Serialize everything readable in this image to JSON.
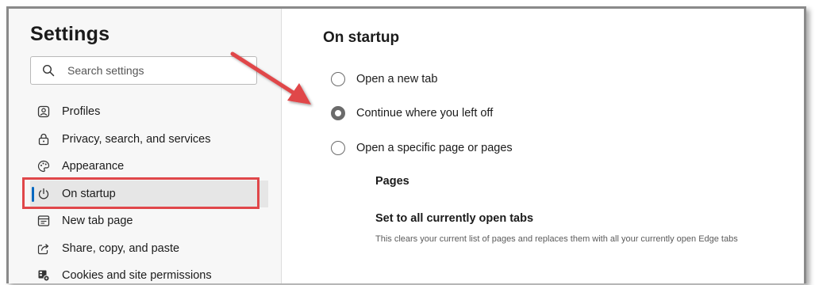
{
  "sidebar": {
    "title": "Settings",
    "search": {
      "placeholder": "Search settings",
      "icon": "search-icon"
    },
    "items": [
      {
        "label": "Profiles",
        "icon": "profile-icon"
      },
      {
        "label": "Privacy, search, and services",
        "icon": "lock-icon"
      },
      {
        "label": "Appearance",
        "icon": "palette-icon"
      },
      {
        "label": "On startup",
        "icon": "power-icon",
        "active": true
      },
      {
        "label": "New tab page",
        "icon": "new-tab-icon"
      },
      {
        "label": "Share, copy, and paste",
        "icon": "share-icon"
      },
      {
        "label": "Cookies and site permissions",
        "icon": "cookie-settings-icon"
      }
    ]
  },
  "content": {
    "title": "On startup",
    "options": [
      {
        "label": "Open a new tab",
        "checked": false
      },
      {
        "label": "Continue where you left off",
        "checked": true
      },
      {
        "label": "Open a specific page or pages",
        "checked": false
      }
    ],
    "pages_label": "Pages",
    "set_tabs_label": "Set to all currently open tabs",
    "set_tabs_desc": "This clears your current list of pages and replaces them with all your currently open Edge tabs"
  },
  "annotation": {
    "highlight_color": "#e0474a",
    "arrow_color": "#e0474a"
  },
  "colors": {
    "accent": "#0067c0",
    "sidebar_bg": "#f7f7f7",
    "active_item_bg": "#e6e6e6"
  }
}
